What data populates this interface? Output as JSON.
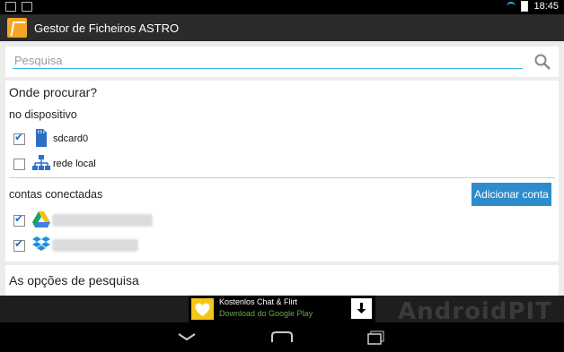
{
  "status_bar": {
    "time": "18:45"
  },
  "app": {
    "title": "Gestor de Ficheiros ASTRO"
  },
  "search": {
    "placeholder": "Pesquisa",
    "value": ""
  },
  "where": {
    "heading": "Onde procurar?",
    "device_section": "no dispositivo",
    "device_items": [
      {
        "label": "sdcard0",
        "checked": true,
        "icon": "sdcard-icon"
      },
      {
        "label": "rede local",
        "checked": false,
        "icon": "network-icon"
      }
    ],
    "accounts_section": "contas conectadas",
    "add_account_label": "Adicionar conta",
    "accounts": [
      {
        "service": "google-drive",
        "checked": true
      },
      {
        "service": "dropbox",
        "checked": true
      }
    ]
  },
  "options": {
    "heading": "As opções de pesquisa"
  },
  "ad": {
    "title": "Kostenlos Chat & Flirt",
    "subtitle": "Download do Google Play"
  },
  "watermark": "AndroidPIT",
  "colors": {
    "accent": "#33b5e5",
    "button": "#2f8ccc",
    "actionbar": "#2b2b2b"
  }
}
